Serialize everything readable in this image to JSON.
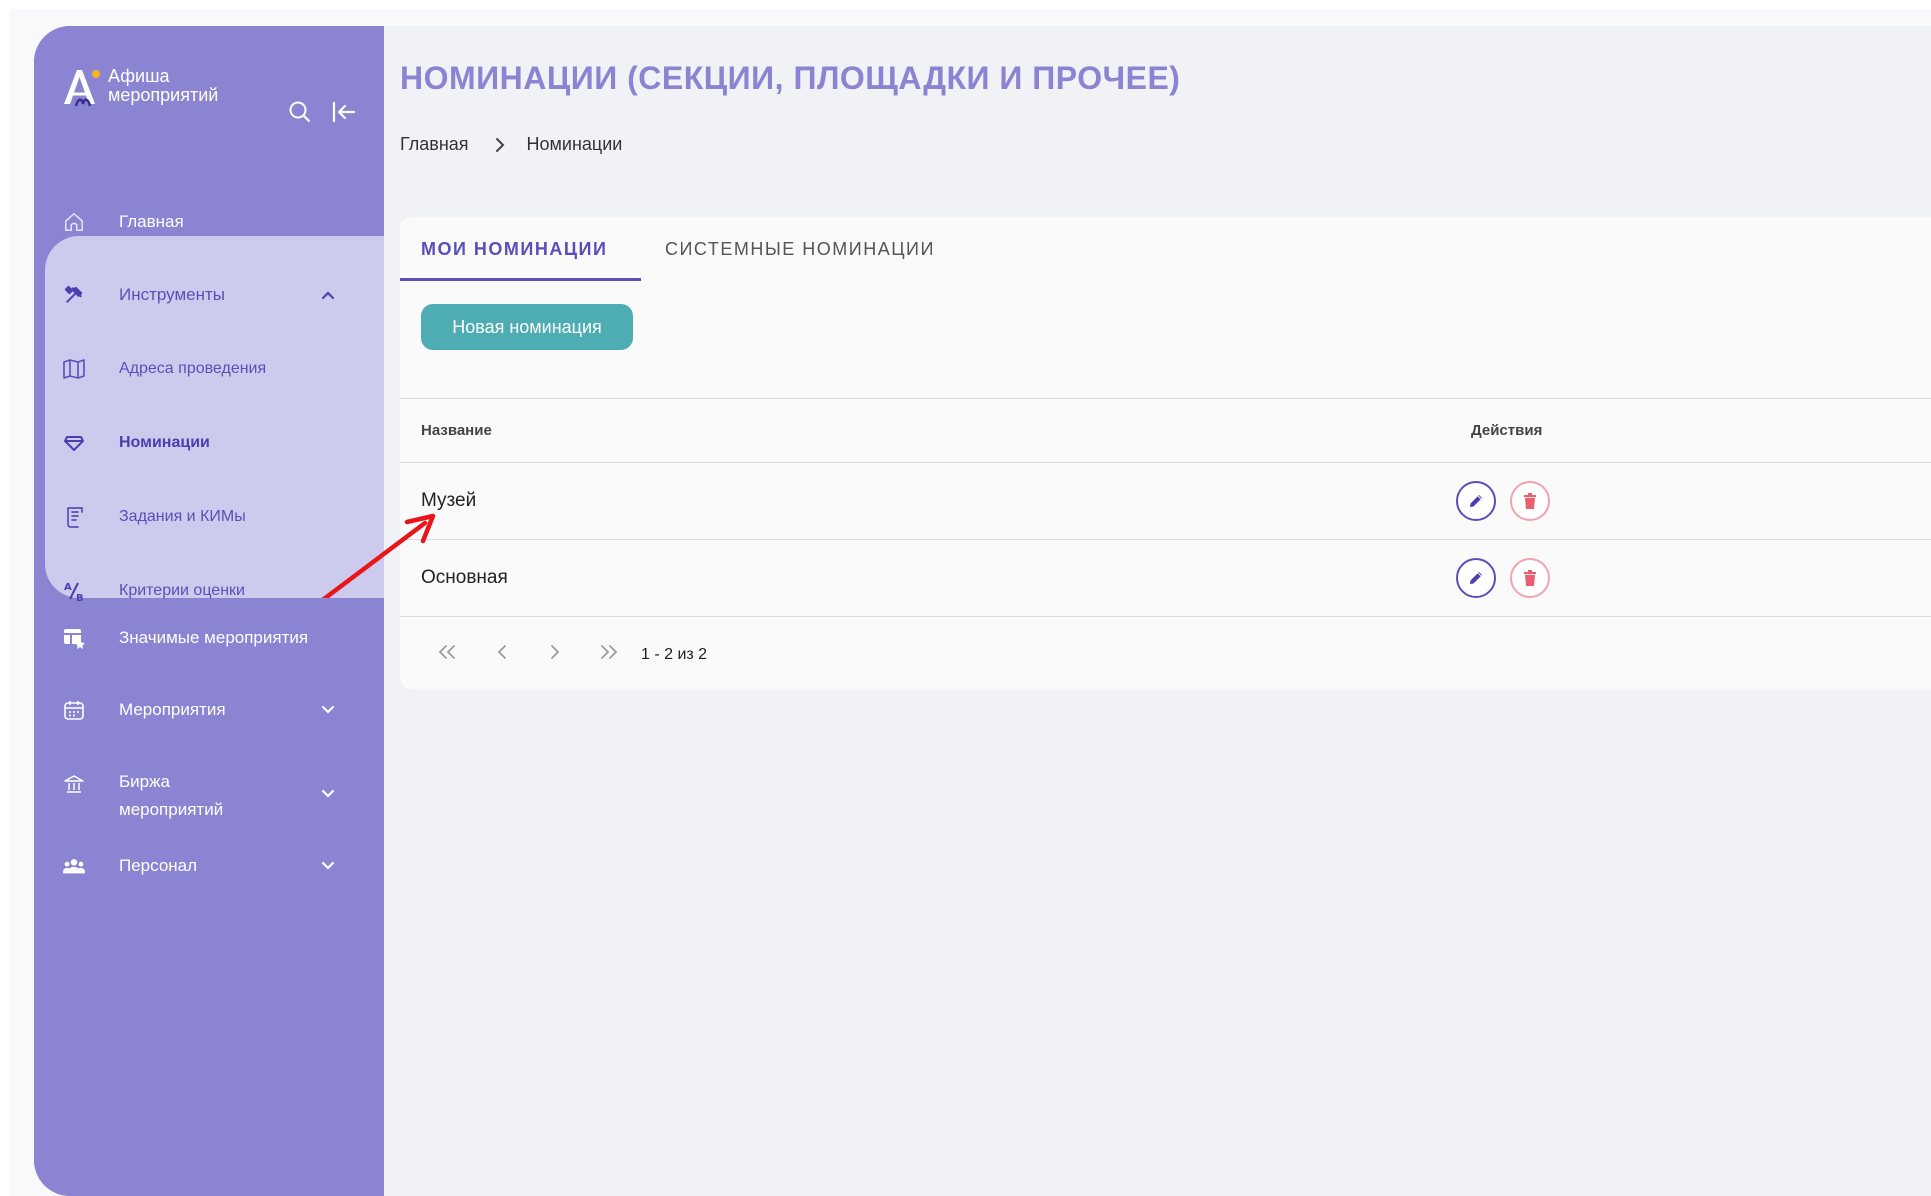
{
  "sidebar": {
    "logo_line1": "Афиша",
    "logo_line2": "мероприятий",
    "logo_mark": "А",
    "items": [
      {
        "label": "Главная",
        "icon": "home-icon"
      },
      {
        "label": "Инструменты",
        "icon": "tools-icon"
      },
      {
        "label": "Адреса проведения",
        "icon": "map-icon"
      },
      {
        "label": "Номинации",
        "icon": "gem-icon"
      },
      {
        "label": "Задания и КИМы",
        "icon": "task-icon"
      },
      {
        "label": "Критерии оценки",
        "icon": "criteria-icon"
      },
      {
        "label": "Значимые мероприятия",
        "icon": "table-star-icon"
      },
      {
        "label": "Мероприятия",
        "icon": "calendar-icon"
      },
      {
        "label": "Биржа мероприятий",
        "icon": "bank-icon"
      },
      {
        "label": "Персонал",
        "icon": "people-icon"
      }
    ],
    "exchange_line1": "Биржа",
    "exchange_line2": "мероприятий"
  },
  "header": {
    "title": "НОМИНАЦИИ (СЕКЦИИ, ПЛОЩАДКИ И ПРОЧЕЕ)",
    "breadcrumb": [
      "Главная",
      "Номинации"
    ]
  },
  "tabs": [
    {
      "label": "МОИ НОМИНАЦИИ",
      "active": true
    },
    {
      "label": "СИСТЕМНЫЕ НОМИНАЦИИ",
      "active": false
    }
  ],
  "new_button": "Новая номинация",
  "table": {
    "columns": [
      "Название",
      "Действия"
    ],
    "rows": [
      {
        "name": "Музей"
      },
      {
        "name": "Основная"
      }
    ]
  },
  "pagination": {
    "info": "1 - 2 из 2"
  },
  "colors": {
    "sidebar": "#8a84d3",
    "accent": "#5a4fb8",
    "button": "#4eadb2",
    "delete": "#e8606f",
    "annotation_arrow": "#e8161b"
  }
}
